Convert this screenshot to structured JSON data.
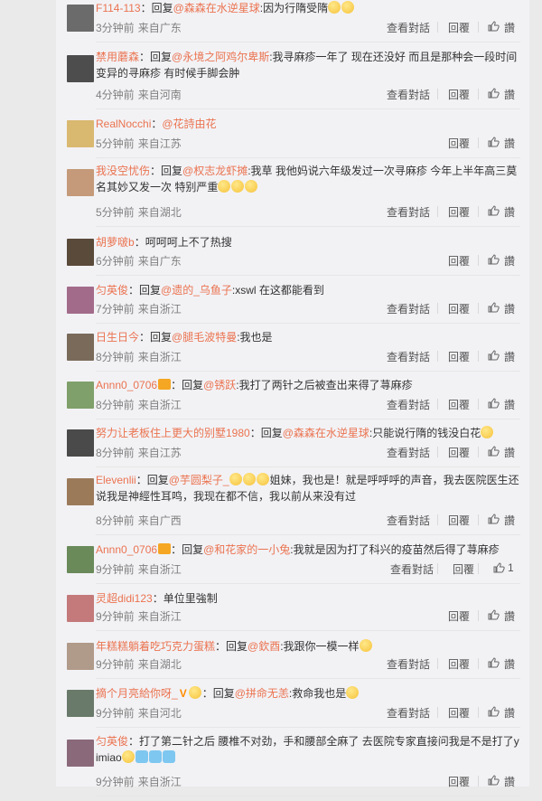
{
  "actions": {
    "view_label": "查看對話",
    "reply_label": "回覆",
    "like_label": "讚"
  },
  "comments": [
    {
      "user": "F114-113",
      "reply": "：回复",
      "to": "@森森在水逆星球",
      "text": ":因为行隋受隋",
      "time": "3分钟前",
      "from": "来自广东",
      "view": true,
      "likes": ""
    },
    {
      "user": "禁用蘑森",
      "reply": "：回复",
      "to": "@永境之阿鸡尔卑斯",
      "text": ":我寻麻疹一年了 现在还没好 而且是那种会一段时间变异的寻麻疹 有时候手脚会肿",
      "time": "4分钟前",
      "from": "来自河南",
      "view": true,
      "likes": ""
    },
    {
      "user": "RealNocchi",
      "reply": "：",
      "to": "@花詩由花",
      "text": "",
      "time": "5分钟前",
      "from": "来自江苏",
      "view": false,
      "likes": ""
    },
    {
      "user": "我没空忧伤",
      "reply": "：回复",
      "to": "@权志龙虾摊",
      "text": ":我草 我他妈说六年级发过一次寻麻疹 今年上半年高三莫名其妙又发一次 特别严重",
      "time": "5分钟前",
      "from": "来自湖北",
      "view": true,
      "likes": ""
    },
    {
      "user": "胡萝啵b",
      "reply": "：",
      "to": "",
      "text": "呵呵呵上不了热搜",
      "time": "6分钟前",
      "from": "来自广东",
      "view": false,
      "likes": ""
    },
    {
      "user": "匀英俊",
      "reply": "：回复",
      "to": "@遗的_乌鱼子",
      "text": ":xswl 在这都能看到",
      "time": "7分钟前",
      "from": "来自浙江",
      "view": true,
      "likes": ""
    },
    {
      "user": "日生日今",
      "reply": "：回复",
      "to": "@腿毛波特曼",
      "text": ":我也是",
      "time": "8分钟前",
      "from": "来自浙江",
      "view": true,
      "likes": ""
    },
    {
      "user": "Annn0_0706",
      "reply": "：回复",
      "to": "@锈跃",
      "text": ":我打了两针之后被查出来得了荨麻疹",
      "time": "8分钟前",
      "from": "来自浙江",
      "view": true,
      "likes": ""
    },
    {
      "user": "努力让老板住上更大的别墅1980",
      "reply": "：回复",
      "to": "@森森在水逆星球",
      "text": ":只能说行隋的钱没白花",
      "time": "8分钟前",
      "from": "来自江苏",
      "view": true,
      "likes": ""
    },
    {
      "user": "Elevenlii",
      "reply": "：回复",
      "to": "@芋圆梨子_",
      "text": "姐妹，我也是！就是呼呼呼的声音，我去医院医生还说我是神經性耳鸣，我现在都不信，我以前从来没有过",
      "time": "8分钟前",
      "from": "来自广西",
      "view": true,
      "likes": ""
    },
    {
      "user": "Annn0_0706",
      "reply": "：回复",
      "to": "@和花家的一小兔",
      "text": ":我就是因为打了科兴的疫苗然后得了荨麻疹",
      "time": "9分钟前",
      "from": "来自浙江",
      "view": true,
      "likes": "1"
    },
    {
      "user": "灵超didi123",
      "reply": "：",
      "to": "",
      "text": "单位里強制",
      "time": "9分钟前",
      "from": "来自浙江",
      "view": false,
      "likes": ""
    },
    {
      "user": "年糕糕躺着吃巧克力蛋糕",
      "reply": "：回复",
      "to": "@欽酉",
      "text": ":我跟你一模一样",
      "time": "9分钟前",
      "from": "来自湖北",
      "view": true,
      "likes": ""
    },
    {
      "user": "摘个月亮給你呀_",
      "reply": "：回复",
      "to": "@拼命无恙",
      "text": ":救命我也是",
      "time": "9分钟前",
      "from": "来自河北",
      "view": true,
      "likes": ""
    },
    {
      "user": "匀英俊",
      "reply": "：",
      "to": "",
      "text": "打了第二针之后 腰椎不对劲，手和腰部全麻了 去医院专家直接问我是不是打了yimiao",
      "time": "9分钟前",
      "from": "来自浙江",
      "view": false,
      "likes": ""
    }
  ]
}
